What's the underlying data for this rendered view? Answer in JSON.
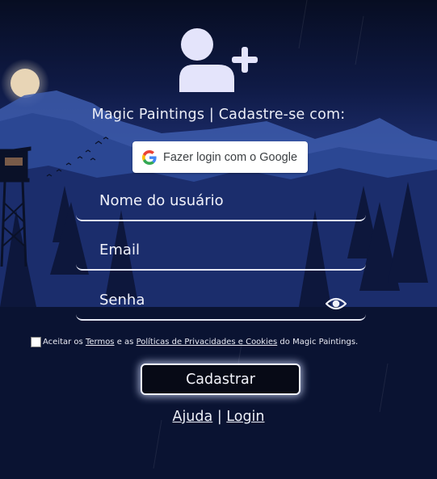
{
  "header": {
    "icon": "user-plus-icon",
    "title": "Magic Paintings | Cadastre-se com:"
  },
  "google": {
    "label": "Fazer login com o Google",
    "icon": "google-g-icon"
  },
  "form": {
    "username_placeholder": "Nome do usuário",
    "email_placeholder": "Email",
    "password_placeholder": "Senha",
    "password_toggle_icon": "eye-icon"
  },
  "terms": {
    "prefix": "Aceitar os ",
    "terms_link": "Termos",
    "middle": " e as ",
    "privacy_link": "Políticas de Privacidades e Cookies",
    "suffix": " do Magic Paintings.",
    "checked": false
  },
  "submit_label": "Cadastrar",
  "footer": {
    "help_link": "Ajuda",
    "separator": "|",
    "login_link": "Login"
  },
  "colors": {
    "sky_top": "#0a1128",
    "sky_mid": "#1b2a6e",
    "mountain": "#2a4a9a",
    "forest": "#0a1230",
    "moon": "#e8d6b8",
    "icon_fill": "#e4e4fb",
    "button_glow": "#d2dcff"
  }
}
